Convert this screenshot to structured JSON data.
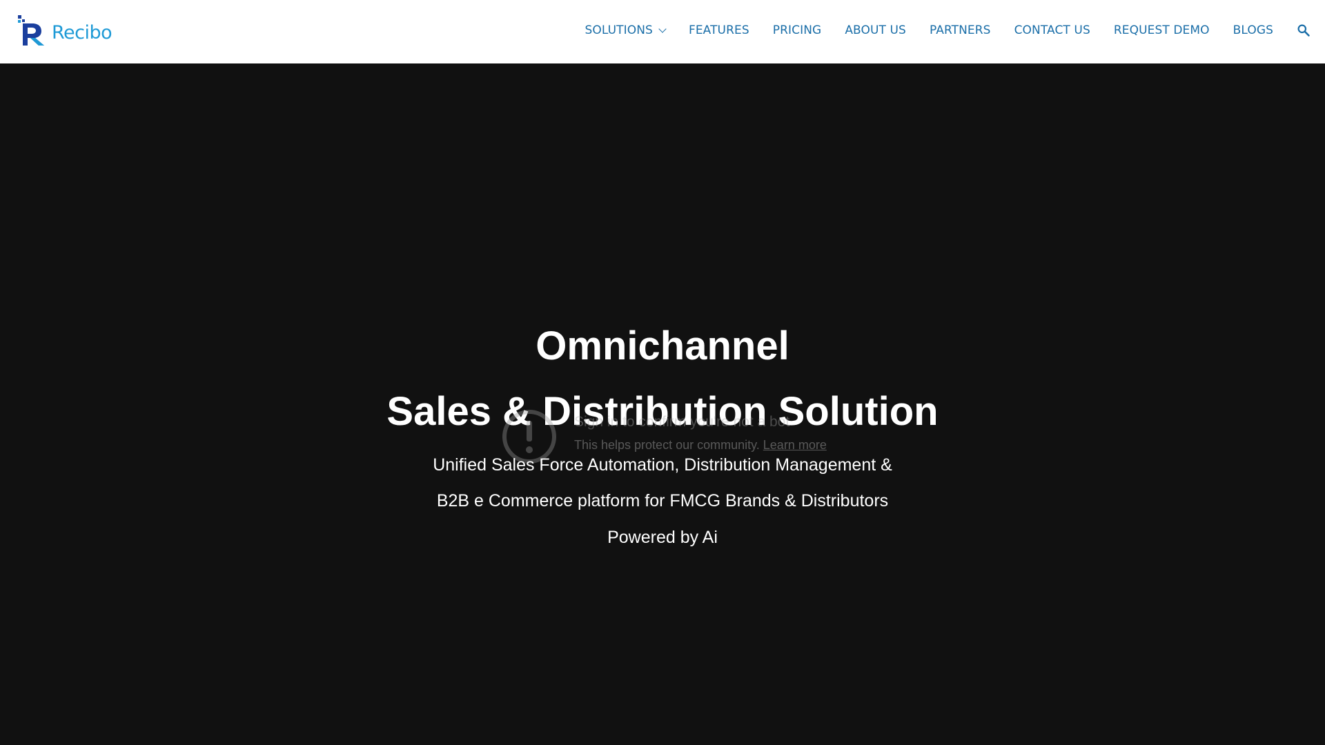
{
  "header": {
    "brand_name": "Recibo",
    "nav": [
      {
        "label": "SOLUTIONS",
        "has_dropdown": true
      },
      {
        "label": "FEATURES"
      },
      {
        "label": "PRICING"
      },
      {
        "label": "ABOUT US"
      },
      {
        "label": "PARTNERS"
      },
      {
        "label": "CONTACT US"
      },
      {
        "label": "REQUEST DEMO"
      },
      {
        "label": "BLOGS"
      }
    ],
    "search_icon": "search-icon"
  },
  "hero": {
    "title_line_1": "Omnichannel",
    "title_line_2": "Sales & Distribution Solution",
    "subtitle_line_1": "Unified Sales Force Automation, Distribution Management &",
    "subtitle_line_2": "B2B e Commerce platform for FMCG Brands & Distributors",
    "subtitle_line_3": "Powered by Ai"
  },
  "captcha": {
    "icon": "alert-circle-icon",
    "title": "Sign in to confirm you're not a bot",
    "note": "This helps protect our community.",
    "link": "Learn more"
  },
  "colors": {
    "nav_text": "#1a6ea8",
    "brand_blue": "#1e9ad6",
    "brand_dark": "#1b3f9e",
    "hero_bg": "#111111",
    "header_bg": "#ffffff"
  }
}
